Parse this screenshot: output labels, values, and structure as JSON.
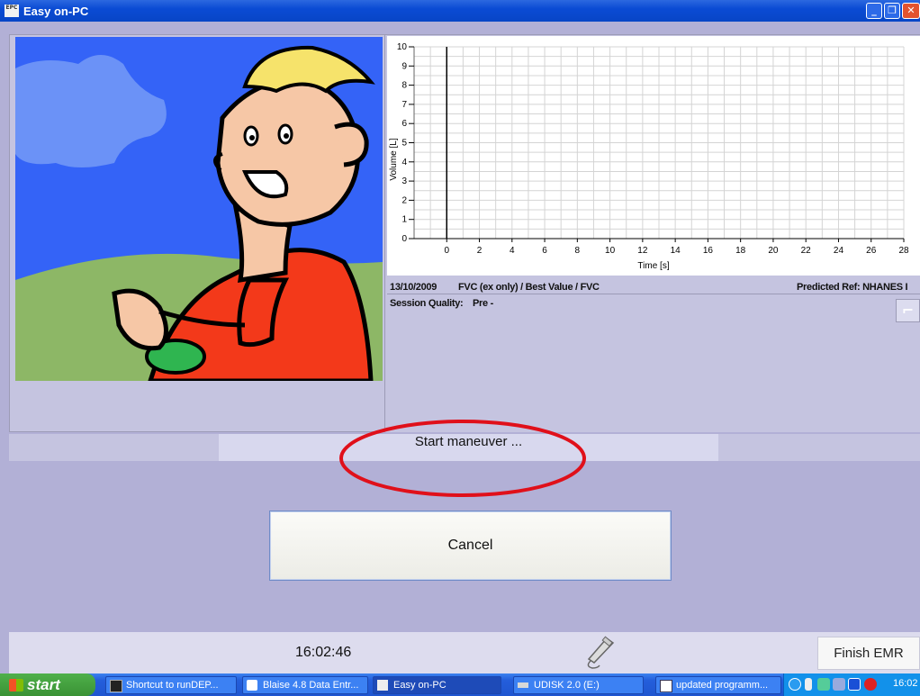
{
  "window": {
    "title": "Easy on-PC",
    "app_icon_text": "EPC"
  },
  "chart_data": {
    "type": "line",
    "xlabel": "Time [s]",
    "ylabel": "Volume [L]",
    "xlim": [
      -2,
      28
    ],
    "ylim": [
      0,
      10
    ],
    "xticks": [
      0,
      2,
      4,
      6,
      8,
      10,
      12,
      14,
      16,
      18,
      20,
      22,
      24,
      26,
      28
    ],
    "yticks": [
      0,
      1,
      2,
      3,
      4,
      5,
      6,
      7,
      8,
      9,
      10
    ],
    "grid": true,
    "series": []
  },
  "info": {
    "date": "13/10/2009",
    "test": "FVC (ex only) / Best Value / FVC",
    "predicted": "Predicted Ref: NHANES I",
    "session_quality_label": "Session Quality:",
    "session_quality_value": "Pre -"
  },
  "status": {
    "message": "Start maneuver ..."
  },
  "buttons": {
    "cancel": "Cancel",
    "finish": "Finish EMR"
  },
  "clock": "16:02:46",
  "colors": {
    "highlight_ellipse": "#e0101a",
    "background": "#b2b0d6"
  },
  "taskbar": {
    "start": "start",
    "tasks": [
      {
        "label": "Shortcut to runDEP...",
        "icon": "cmd-icon"
      },
      {
        "label": "Blaise 4.8 Data Entr...",
        "icon": "blaise-icon"
      },
      {
        "label": "Easy on-PC",
        "icon": "epc-icon",
        "active": true
      },
      {
        "label": "UDISK 2.0 (E:)",
        "icon": "drive-icon"
      },
      {
        "label": "updated programm...",
        "icon": "document-icon"
      }
    ],
    "tray_time": "16:02"
  }
}
